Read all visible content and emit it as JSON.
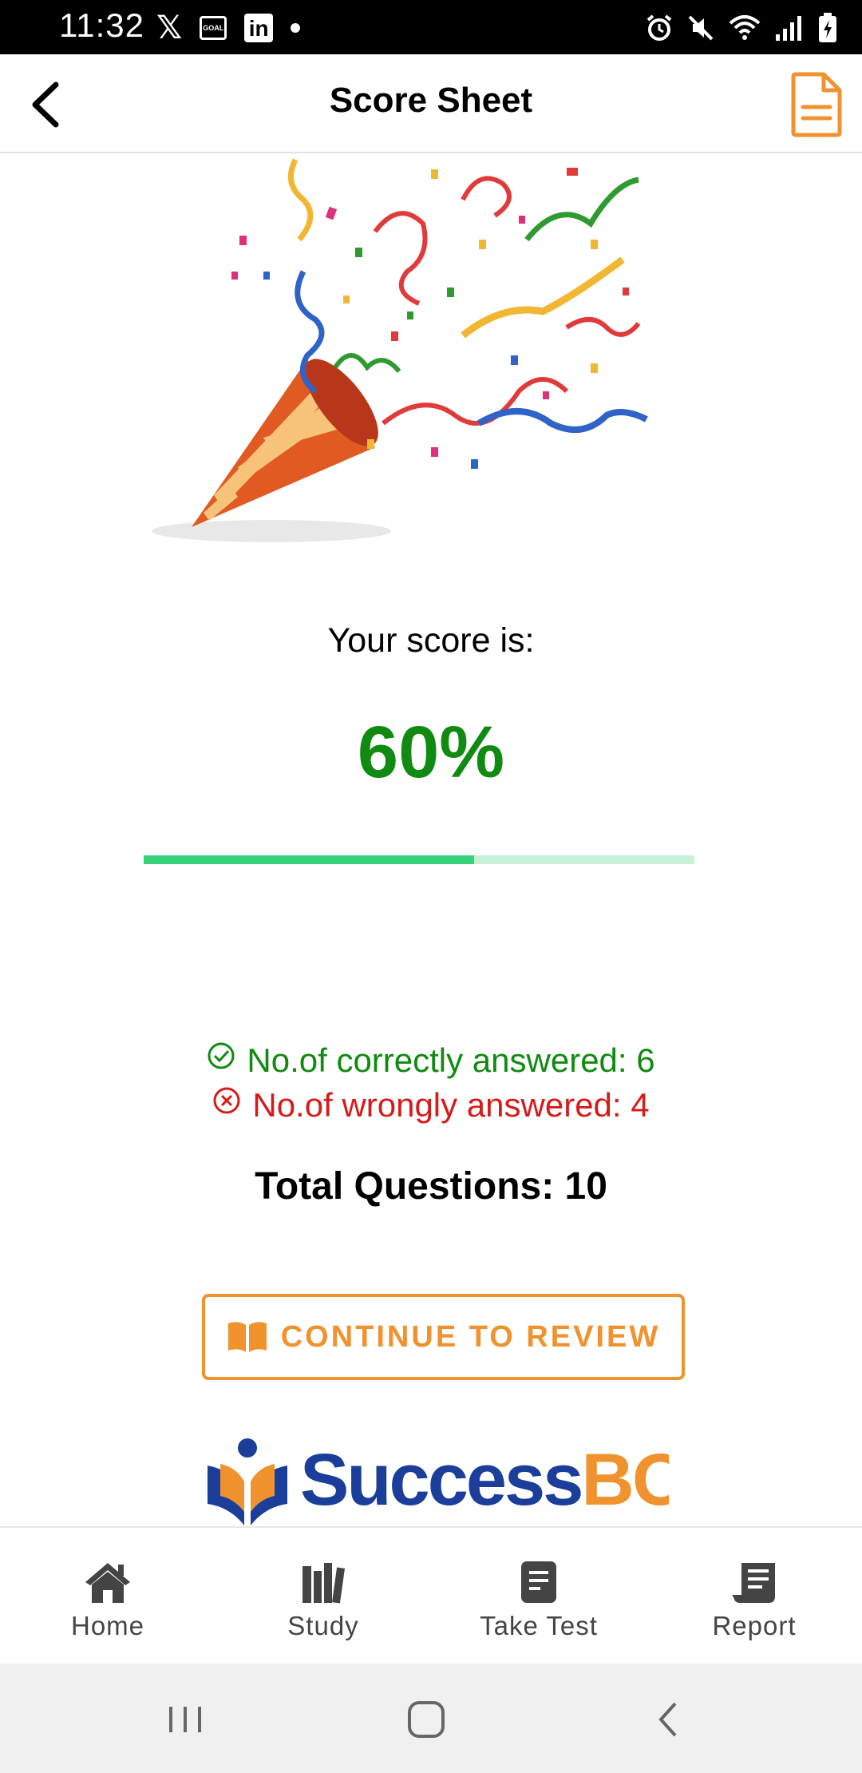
{
  "status_bar": {
    "time": "11:32",
    "left_icons": [
      "x-icon",
      "goal-icon",
      "linkedin-icon",
      "dot-icon"
    ],
    "goal_icon_text": "GOAL",
    "right_icons": [
      "alarm-icon",
      "mute-icon",
      "wifi-icon",
      "signal-icon",
      "battery-charging-icon"
    ]
  },
  "header": {
    "title": "Score Sheet",
    "back_icon": "chevron-left-icon",
    "action_icon": "document-icon"
  },
  "result": {
    "score_label": "Your score is:",
    "score_value": "60%",
    "progress_fraction": 0.6,
    "correct_text": "No.of correctly answered: 6",
    "wrong_text": "No.of wrongly answered: 4",
    "total_text": "Total Questions: 10"
  },
  "review_button": {
    "label": "CONTINUE TO REVIEW",
    "icon": "open-book-icon"
  },
  "brand": {
    "part1": "Success",
    "part2": "BOX"
  },
  "bottom_nav": {
    "items": [
      {
        "label": "Home",
        "icon": "home-icon"
      },
      {
        "label": "Study",
        "icon": "books-icon"
      },
      {
        "label": "Take Test",
        "icon": "test-icon"
      },
      {
        "label": "Report",
        "icon": "report-icon"
      }
    ]
  },
  "system_nav": [
    "recents-button",
    "home-button",
    "back-button"
  ],
  "colors": {
    "accent": "#f0922e",
    "correct": "#108a10",
    "wrong": "#d71a1a",
    "progress_fill": "#36d27a",
    "progress_track": "#c6f1d6",
    "brand_blue": "#1a3e9a"
  }
}
